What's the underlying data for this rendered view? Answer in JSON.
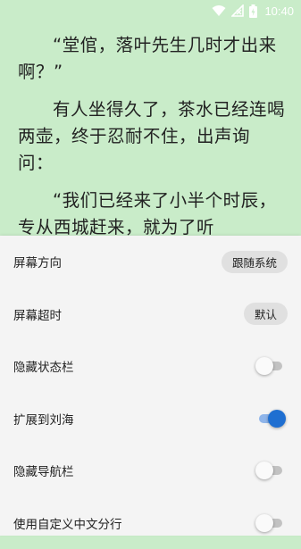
{
  "status_bar": {
    "time": "10:40"
  },
  "reader": {
    "paragraphs": [
      "“堂倌，落叶先生几时才出来啊？”",
      "有人坐得久了，茶水已经连喝两壶，终于忍耐不住，出声询问：",
      "“我们已经来了小半个时辰，专从西城赶来，就为了听"
    ]
  },
  "settings": {
    "screen_orientation": {
      "label": "屏幕方向",
      "value": "跟随系统"
    },
    "screen_timeout": {
      "label": "屏幕超时",
      "value": "默认"
    },
    "hide_status_bar": {
      "label": "隐藏状态栏",
      "enabled": false
    },
    "extend_to_notch": {
      "label": "扩展到刘海",
      "enabled": true
    },
    "hide_nav_bar": {
      "label": "隐藏导航栏",
      "enabled": false
    },
    "custom_chinese_line_break": {
      "label": "使用自定义中文分行",
      "enabled": false
    }
  }
}
